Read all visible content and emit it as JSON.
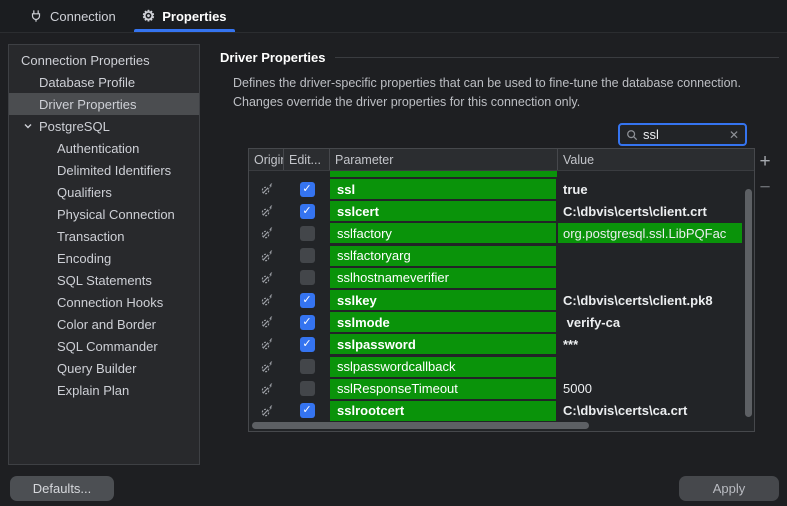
{
  "tabs": [
    {
      "label": "Connection",
      "icon": "plug-icon",
      "active": false
    },
    {
      "label": "Properties",
      "icon": "gear-icon",
      "active": true
    }
  ],
  "sidebar": {
    "items": [
      {
        "label": "Connection Properties",
        "level": 0,
        "selected": false,
        "expanded": null
      },
      {
        "label": "Database Profile",
        "level": 1,
        "selected": false,
        "expanded": null
      },
      {
        "label": "Driver Properties",
        "level": 1,
        "selected": true,
        "expanded": null
      },
      {
        "label": "PostgreSQL",
        "level": 1,
        "selected": false,
        "expanded": true
      },
      {
        "label": "Authentication",
        "level": 2,
        "selected": false,
        "expanded": null
      },
      {
        "label": "Delimited Identifiers",
        "level": 2,
        "selected": false,
        "expanded": null
      },
      {
        "label": "Qualifiers",
        "level": 2,
        "selected": false,
        "expanded": null
      },
      {
        "label": "Physical Connection",
        "level": 2,
        "selected": false,
        "expanded": null
      },
      {
        "label": "Transaction",
        "level": 2,
        "selected": false,
        "expanded": null
      },
      {
        "label": "Encoding",
        "level": 2,
        "selected": false,
        "expanded": null
      },
      {
        "label": "SQL Statements",
        "level": 2,
        "selected": false,
        "expanded": null
      },
      {
        "label": "Connection Hooks",
        "level": 2,
        "selected": false,
        "expanded": null
      },
      {
        "label": "Color and Border",
        "level": 2,
        "selected": false,
        "expanded": null
      },
      {
        "label": "SQL Commander",
        "level": 2,
        "selected": false,
        "expanded": null
      },
      {
        "label": "Query Builder",
        "level": 2,
        "selected": false,
        "expanded": null
      },
      {
        "label": "Explain Plan",
        "level": 2,
        "selected": false,
        "expanded": null
      }
    ]
  },
  "main": {
    "section_title": "Driver Properties",
    "description_line1": "Defines the driver-specific properties that can be used to fine-tune the database connection.",
    "description_line2": "Changes override the driver properties for this connection only.",
    "search": {
      "value": "ssl",
      "clear_icon": "✕"
    },
    "add_button": "+",
    "remove_button": "−",
    "table": {
      "columns": [
        "Origin",
        "Edit...",
        "Parameter",
        "Value"
      ],
      "origin_icon": "driver-icon",
      "rows": [
        {
          "param": "ssl",
          "value": "true",
          "edited": true,
          "value_match": false
        },
        {
          "param": "sslcert",
          "value": "C:\\dbvis\\certs\\client.crt",
          "edited": true,
          "value_match": false
        },
        {
          "param": "sslfactory",
          "value": "org.postgresql.ssl.LibPQFac",
          "edited": false,
          "value_match": true
        },
        {
          "param": "sslfactoryarg",
          "value": "",
          "edited": false,
          "value_match": false
        },
        {
          "param": "sslhostnameverifier",
          "value": "",
          "edited": false,
          "value_match": false
        },
        {
          "param": "sslkey",
          "value": "C:\\dbvis\\certs\\client.pk8",
          "edited": true,
          "value_match": false
        },
        {
          "param": "sslmode",
          "value": " verify-ca",
          "edited": true,
          "value_match": false
        },
        {
          "param": "sslpassword",
          "value": "***",
          "edited": true,
          "value_match": false
        },
        {
          "param": "sslpasswordcallback",
          "value": "",
          "edited": false,
          "value_match": false
        },
        {
          "param": "sslResponseTimeout",
          "value": "5000",
          "edited": false,
          "value_match": false
        },
        {
          "param": "sslrootcert",
          "value": "C:\\dbvis\\certs\\ca.crt",
          "edited": true,
          "value_match": false
        }
      ]
    }
  },
  "footer": {
    "defaults_label": "Defaults...",
    "apply_label": "Apply"
  },
  "colors": {
    "accent_blue": "#3574f0",
    "match_green": "#0a930a",
    "window_bg": "#1e1f22",
    "sidebar_bg": "#28292c",
    "selection_gray": "#4b4d50"
  }
}
